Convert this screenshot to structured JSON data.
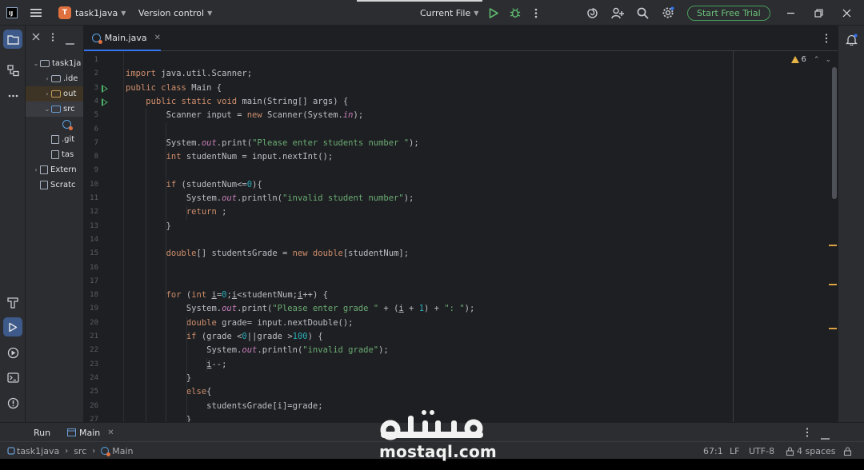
{
  "titlebar": {
    "project_badge": "T",
    "project_name": "task1java",
    "vcs_label": "Version control",
    "run_config": "Current File",
    "trial_button": "Start Free Trial"
  },
  "project_tree": [
    {
      "label": "task1ja",
      "depth": 0,
      "expanded": true,
      "icon": "folder-icon"
    },
    {
      "label": ".ide",
      "depth": 1,
      "expanded": false,
      "icon": "folder-icon"
    },
    {
      "label": "out",
      "depth": 1,
      "expanded": false,
      "icon": "folder-icon"
    },
    {
      "label": "src",
      "depth": 1,
      "expanded": true,
      "icon": "folder-icon"
    },
    {
      "label": "",
      "depth": 2,
      "expanded": null,
      "icon": "java-class-icon"
    },
    {
      "label": ".git",
      "depth": 1,
      "expanded": null,
      "icon": "file-icon"
    },
    {
      "label": "tas",
      "depth": 1,
      "expanded": null,
      "icon": "file-icon"
    },
    {
      "label": "Extern",
      "depth": 0,
      "expanded": false,
      "icon": "library-icon"
    },
    {
      "label": "Scratc",
      "depth": 0,
      "expanded": null,
      "icon": "scratch-icon"
    }
  ],
  "editor": {
    "tab_label": "Main.java",
    "warnings_count": "6",
    "run_marker_lines": [
      3,
      4
    ],
    "lines": [
      {
        "n": "1",
        "code": ""
      },
      {
        "n": "2",
        "code": "import java.util.Scanner;"
      },
      {
        "n": "3",
        "code": "public class Main {"
      },
      {
        "n": "4",
        "code": "    public static void main(String[] args) {"
      },
      {
        "n": "5",
        "code": "        Scanner input = new Scanner(System.in);"
      },
      {
        "n": "6",
        "code": ""
      },
      {
        "n": "7",
        "code": "        System.out.print(\"Please enter students number \");"
      },
      {
        "n": "8",
        "code": "        int studentNum = input.nextInt();"
      },
      {
        "n": "9",
        "code": ""
      },
      {
        "n": "10",
        "code": "        if (studentNum<=0){"
      },
      {
        "n": "11",
        "code": "            System.out.println(\"invalid student number\");"
      },
      {
        "n": "12",
        "code": "            return ;"
      },
      {
        "n": "13",
        "code": "        }"
      },
      {
        "n": "14",
        "code": ""
      },
      {
        "n": "15",
        "code": "        double[] studentsGrade = new double[studentNum];"
      },
      {
        "n": "16",
        "code": ""
      },
      {
        "n": "17",
        "code": ""
      },
      {
        "n": "18",
        "code": "        for (int i=0;i<studentNum;i++) {"
      },
      {
        "n": "19",
        "code": "            System.out.print(\"Please enter grade \" + (i + 1) + \": \");"
      },
      {
        "n": "20",
        "code": "            double grade= input.nextDouble();"
      },
      {
        "n": "21",
        "code": "            if (grade <0||grade >100) {"
      },
      {
        "n": "22",
        "code": "                System.out.println(\"invalid grade\");"
      },
      {
        "n": "23",
        "code": "                i--;"
      },
      {
        "n": "24",
        "code": "            }"
      },
      {
        "n": "25",
        "code": "            else{"
      },
      {
        "n": "26",
        "code": "                studentsGrade[i]=grade;"
      },
      {
        "n": "27",
        "code": "            }"
      }
    ]
  },
  "runbar": {
    "run_label": "Run",
    "main_tab": "Main"
  },
  "statusbar": {
    "breadcrumbs": [
      "task1java",
      "src",
      "Main"
    ],
    "position": "67:1",
    "line_sep": "LF",
    "encoding": "UTF-8",
    "indent": "4 spaces"
  },
  "watermark": {
    "arabic": "مستقل",
    "latin": "mostaql.com"
  },
  "colors": {
    "keyword": "#cf8e6d",
    "string": "#6aab73",
    "number": "#2aacb8",
    "static_field": "#c77dbb",
    "accent": "#3574f0",
    "trial_green": "#4a9e5c"
  }
}
